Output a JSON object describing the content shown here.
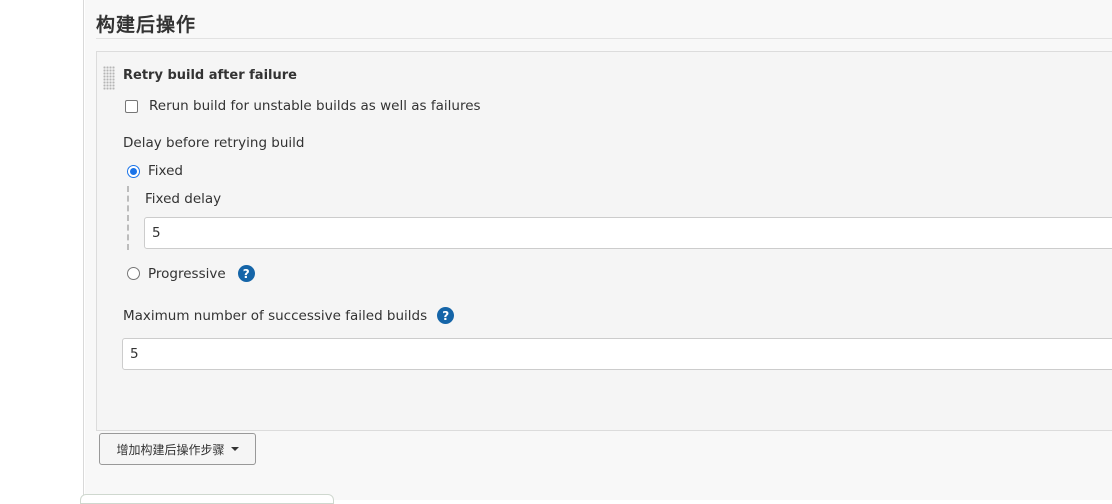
{
  "section": {
    "title": "构建后操作"
  },
  "retry_step": {
    "title": "Retry build after failure",
    "rerun_checkbox_label": "Rerun build for unstable builds as well as failures",
    "rerun_checked": false,
    "delay_label": "Delay before retrying build",
    "delay_options": {
      "fixed_label": "Fixed",
      "progressive_label": "Progressive",
      "selected": "Fixed"
    },
    "fixed_delay_label": "Fixed delay",
    "fixed_delay_value": "5",
    "max_failed_label": "Maximum number of successive failed builds",
    "max_failed_value": "5"
  },
  "actions": {
    "add_post_build_step_label": "增加构建后操作步骤"
  },
  "icons": {
    "help": "help-icon",
    "dropdown": "caret-down-icon",
    "drag": "drag-handle-icon"
  },
  "colors": {
    "accent": "#1a73e8",
    "help_icon": "#1565a8"
  }
}
